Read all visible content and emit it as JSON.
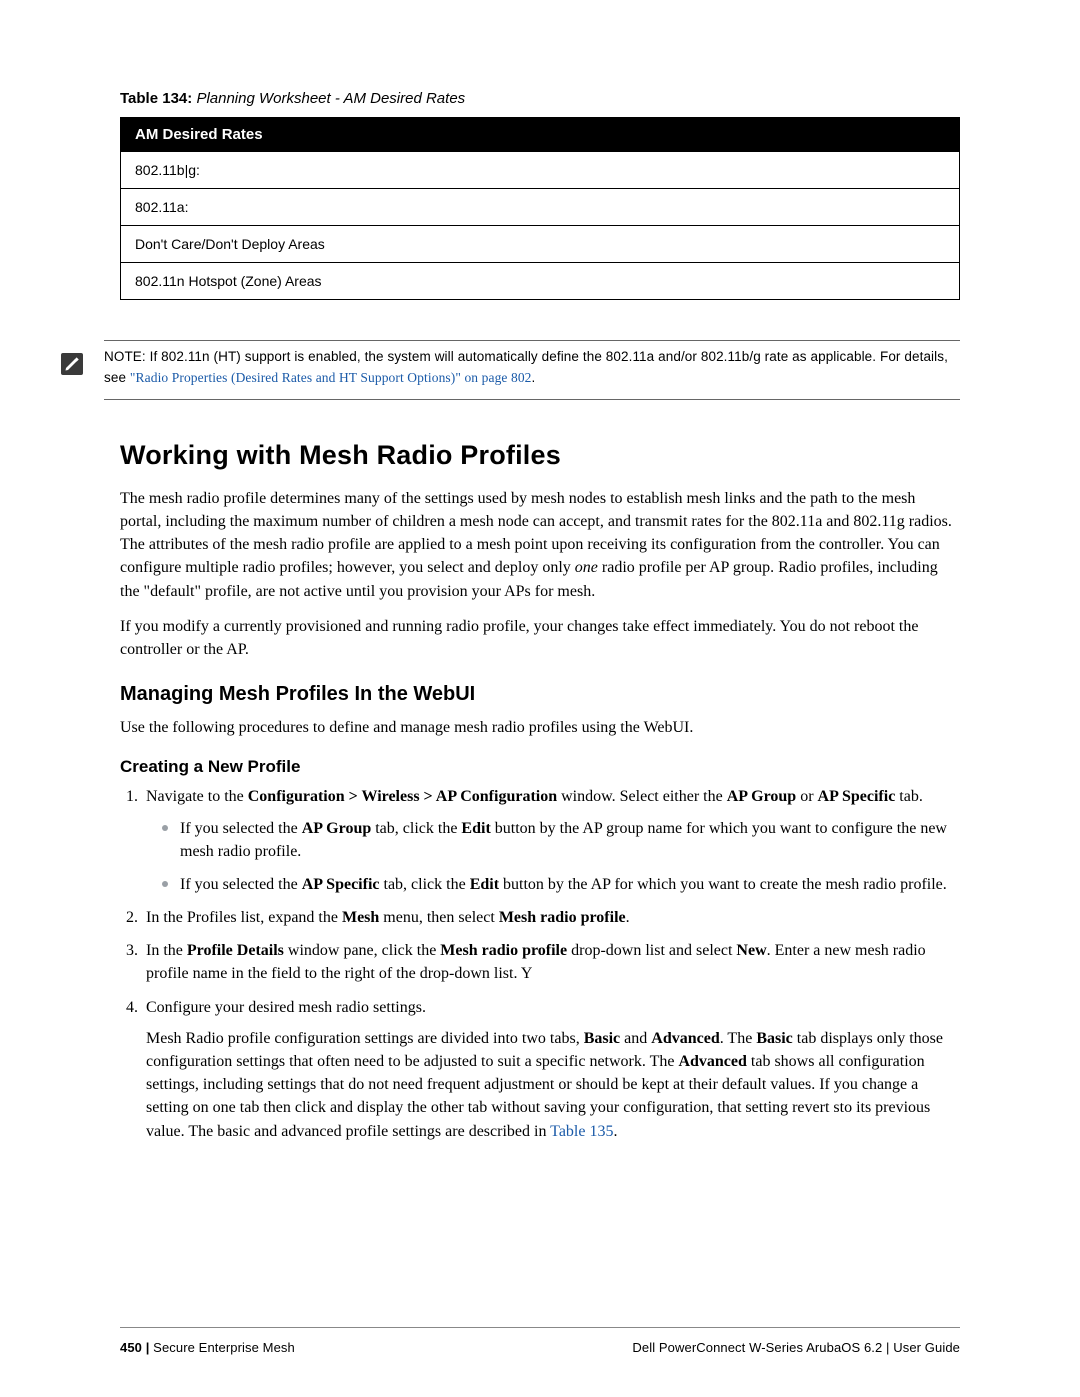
{
  "table": {
    "caption_prefix": "Table 134:",
    "caption_title": "Planning Worksheet - AM Desired Rates",
    "header": "AM Desired Rates",
    "rows": [
      "802.11b|g:",
      "802.11a:",
      "Don't Care/Don't Deploy Areas",
      "802.11n Hotspot (Zone) Areas"
    ]
  },
  "note": {
    "text_prefix": "NOTE: If 802.11n (HT) support is enabled, the system will automatically define the 802.11a and/or 802.11b/g rate as applicable. For details, see ",
    "link_text": "\"Radio Properties (Desired Rates and HT Support Options)\" on page 802",
    "text_suffix": "."
  },
  "headings": {
    "h1": "Working with Mesh Radio Profiles",
    "h2": "Managing Mesh Profiles In the WebUI",
    "h3": "Creating a New Profile"
  },
  "paragraphs": {
    "p1_a": "The mesh radio profile determines many of the settings used by mesh nodes to establish mesh links and the path to the mesh portal, including the maximum number of children a mesh node can accept, and transmit rates for the 802.11a and 802.11g radios. The attributes of the mesh radio profile are applied to a mesh point upon receiving its configuration from the controller. You can configure multiple radio profiles; however, you select and deploy only ",
    "p1_italic": "one",
    "p1_b": " radio profile per AP group. Radio profiles, including the \"default\" profile, are not active until you provision your APs for mesh.",
    "p2": "If you modify a currently provisioned and running radio profile, your changes take effect immediately. You do not reboot the controller or the AP.",
    "p3": "Use the following procedures to define and manage mesh radio profiles using the WebUI."
  },
  "steps": {
    "s1_a": "Navigate to the ",
    "s1_b1": "Configuration > Wireless > AP Configuration",
    "s1_c": " window. Select either the ",
    "s1_b2": "AP Group",
    "s1_d": " or ",
    "s1_b3": "AP Specific",
    "s1_e": " tab.",
    "s1_sub1_a": "If you selected the ",
    "s1_sub1_b1": "AP Group",
    "s1_sub1_b": " tab, click the ",
    "s1_sub1_b2": "Edit",
    "s1_sub1_c": " button by the AP group name for which you want to configure the new mesh radio profile.",
    "s1_sub2_a": "If you selected the ",
    "s1_sub2_b1": "AP Specific",
    "s1_sub2_b": " tab, click the ",
    "s1_sub2_b2": "Edit",
    "s1_sub2_c": " button by the AP for which you want to create the mesh radio profile.",
    "s2_a": "In the Profiles list, expand the ",
    "s2_b1": "Mesh",
    "s2_b": " menu, then select ",
    "s2_b2": "Mesh radio profile",
    "s2_c": ".",
    "s3_a": "In the ",
    "s3_b1": "Profile Details",
    "s3_b": " window pane, click the ",
    "s3_b2": "Mesh radio profile",
    "s3_c": " drop-down list and select ",
    "s3_b3": "New",
    "s3_d": ". Enter a new mesh radio profile name in the field to the right of the drop-down list. Y",
    "s4": "Configure your desired mesh radio settings.",
    "s4_extra_a": "Mesh Radio profile configuration settings are divided into two tabs, ",
    "s4_extra_b1": "Basic",
    "s4_extra_b": " and ",
    "s4_extra_b2": "Advanced",
    "s4_extra_c": ". The ",
    "s4_extra_b3": "Basic",
    "s4_extra_d": " tab displays only those configuration settings that often need to be adjusted to suit a specific network. The ",
    "s4_extra_b4": "Advanced",
    "s4_extra_e": " tab shows all configuration settings, including settings that do not need frequent adjustment or should be kept at their default values. If you change a setting on one tab then click and display the other tab without saving your configuration, that setting revert sto its previous value. The basic and advanced profile settings are described in ",
    "s4_link": "Table 135",
    "s4_extra_f": "."
  },
  "footer": {
    "page_number": "450",
    "left_text": "Secure Enterprise Mesh",
    "right_text": "Dell PowerConnect W-Series ArubaOS 6.2  |  User Guide"
  }
}
